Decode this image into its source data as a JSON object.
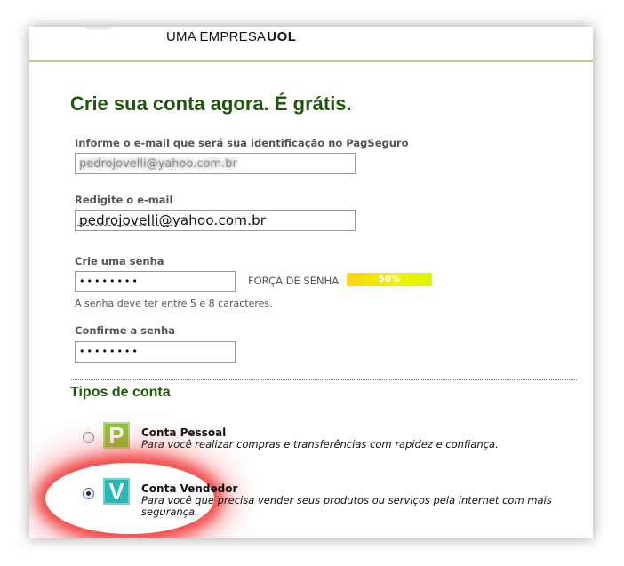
{
  "header": {
    "brand_prefix": "UMA EMPRESA",
    "brand_strong": "UOL"
  },
  "page_title": "Crie sua conta agora. É grátis.",
  "form": {
    "email": {
      "label": "Informe o e-mail que será sua identificação no PagSeguro",
      "value": "pedrojovelli@yahoo.com.br"
    },
    "email_confirm": {
      "label": "Redigite o e-mail",
      "value": "pedrojovelli@yahoo.com.br"
    },
    "password": {
      "label": "Crie uma senha",
      "value": "••••••••",
      "strength_label": "FORÇA DE SENHA",
      "strength_value": "50%",
      "strength_fraction": 0.5,
      "hint": "A senha deve ter entre 5 e 8 caracteres."
    },
    "password_confirm": {
      "label": "Confirme a senha",
      "value": "••••••••"
    }
  },
  "account_types": {
    "title": "Tipos de conta",
    "options": [
      {
        "icon_letter": "P",
        "icon_color": "#8cc63f",
        "name": "Conta Pessoal",
        "description": "Para você realizar compras e transferências com rapidez e confiança.",
        "selected": false
      },
      {
        "icon_letter": "V",
        "icon_color": "#2ab8b4",
        "name": "Conta Vendedor",
        "description": "Para você que precisa vender seus produtos ou serviços pela internet com mais segurança.",
        "selected": true
      }
    ]
  },
  "colors": {
    "title_green": "#1d5709",
    "header_rule": "#b7d08d",
    "strength_yellow": "#ffd21a",
    "highlight_red": "#f02828"
  }
}
